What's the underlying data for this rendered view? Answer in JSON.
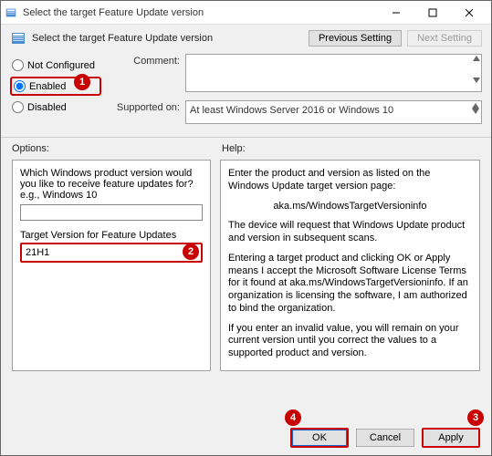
{
  "window": {
    "title": "Select the target Feature Update version",
    "subtitle": "Select the target Feature Update version"
  },
  "nav": {
    "previous": "Previous Setting",
    "next": "Next Setting"
  },
  "state": {
    "options": [
      {
        "id": "not-configured",
        "label": "Not Configured",
        "checked": false
      },
      {
        "id": "enabled",
        "label": "Enabled",
        "checked": true
      },
      {
        "id": "disabled",
        "label": "Disabled",
        "checked": false
      }
    ]
  },
  "fields": {
    "comment_label": "Comment:",
    "comment_value": "",
    "supported_label": "Supported on:",
    "supported_value": "At least Windows Server 2016 or Windows 10"
  },
  "section_headers": {
    "options": "Options:",
    "help": "Help:"
  },
  "options_panel": {
    "question": "Which Windows product version would you like to receive feature updates for? e.g., Windows 10",
    "product_value": "",
    "target_label": "Target Version for Feature Updates",
    "target_value": "21H1"
  },
  "help_panel": {
    "p1": "Enter the product and version as listed on the Windows Update target version page:",
    "p2": "aka.ms/WindowsTargetVersioninfo",
    "p3": "The device will request that Windows Update product and version in subsequent scans.",
    "p4": "Entering a target product and clicking OK or Apply means I accept the Microsoft Software License Terms for it found at aka.ms/WindowsTargetVersioninfo. If an organization is licensing the software, I am authorized to bind the organization.",
    "p5": "If you enter an invalid value, you will remain on your current version until you correct the values to a supported product and version."
  },
  "buttons": {
    "ok": "OK",
    "cancel": "Cancel",
    "apply": "Apply"
  },
  "callouts": {
    "c1": "1",
    "c2": "2",
    "c3": "3",
    "c4": "4"
  }
}
